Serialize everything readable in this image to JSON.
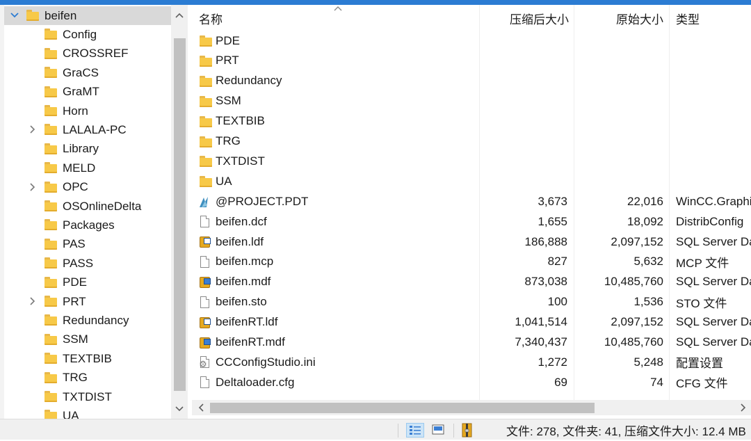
{
  "tree": {
    "items": [
      {
        "label": "beifen",
        "level": 0,
        "expanded": true,
        "selected": true
      },
      {
        "label": "Config",
        "level": 1
      },
      {
        "label": "CROSSREF",
        "level": 1
      },
      {
        "label": "GraCS",
        "level": 1
      },
      {
        "label": "GraMT",
        "level": 1
      },
      {
        "label": "Horn",
        "level": 1
      },
      {
        "label": "LALALA-PC",
        "level": 1,
        "has_children": true
      },
      {
        "label": "Library",
        "level": 1
      },
      {
        "label": "MELD",
        "level": 1
      },
      {
        "label": "OPC",
        "level": 1,
        "has_children": true
      },
      {
        "label": "OSOnlineDelta",
        "level": 1
      },
      {
        "label": "Packages",
        "level": 1
      },
      {
        "label": "PAS",
        "level": 1
      },
      {
        "label": "PASS",
        "level": 1
      },
      {
        "label": "PDE",
        "level": 1
      },
      {
        "label": "PRT",
        "level": 1,
        "has_children": true
      },
      {
        "label": "Redundancy",
        "level": 1
      },
      {
        "label": "SSM",
        "level": 1
      },
      {
        "label": "TEXTBIB",
        "level": 1
      },
      {
        "label": "TRG",
        "level": 1
      },
      {
        "label": "TXTDIST",
        "level": 1
      },
      {
        "label": "UA",
        "level": 1
      }
    ],
    "scroll_up_icon": "chevron-up-icon",
    "scroll_down_icon": "chevron-down-icon"
  },
  "list": {
    "columns": {
      "name": "名称",
      "compressed": "压缩后大小",
      "original": "原始大小",
      "type": "类型"
    },
    "rows": [
      {
        "icon": "folder-icon",
        "name": "PDE",
        "compressed": "",
        "original": "",
        "type": ""
      },
      {
        "icon": "folder-icon",
        "name": "PRT",
        "compressed": "",
        "original": "",
        "type": ""
      },
      {
        "icon": "folder-icon",
        "name": "Redundancy",
        "compressed": "",
        "original": "",
        "type": ""
      },
      {
        "icon": "folder-icon",
        "name": "SSM",
        "compressed": "",
        "original": "",
        "type": ""
      },
      {
        "icon": "folder-icon",
        "name": "TEXTBIB",
        "compressed": "",
        "original": "",
        "type": ""
      },
      {
        "icon": "folder-icon",
        "name": "TRG",
        "compressed": "",
        "original": "",
        "type": ""
      },
      {
        "icon": "folder-icon",
        "name": "TXTDIST",
        "compressed": "",
        "original": "",
        "type": ""
      },
      {
        "icon": "folder-icon",
        "name": "UA",
        "compressed": "",
        "original": "",
        "type": ""
      },
      {
        "icon": "wincc-graphics-icon",
        "name": "@PROJECT.PDT",
        "compressed": "3,673",
        "original": "22,016",
        "type": "WinCC.Graphi"
      },
      {
        "icon": "document-icon",
        "name": "beifen.dcf",
        "compressed": "1,655",
        "original": "18,092",
        "type": "DistribConfig"
      },
      {
        "icon": "database-log-icon",
        "name": "beifen.ldf",
        "compressed": "186,888",
        "original": "2,097,152",
        "type": "SQL Server Da"
      },
      {
        "icon": "document-icon",
        "name": "beifen.mcp",
        "compressed": "827",
        "original": "5,632",
        "type": "MCP 文件"
      },
      {
        "icon": "database-data-icon",
        "name": "beifen.mdf",
        "compressed": "873,038",
        "original": "10,485,760",
        "type": "SQL Server Da"
      },
      {
        "icon": "document-icon",
        "name": "beifen.sto",
        "compressed": "100",
        "original": "1,536",
        "type": "STO 文件"
      },
      {
        "icon": "database-log-icon",
        "name": "beifenRT.ldf",
        "compressed": "1,041,514",
        "original": "2,097,152",
        "type": "SQL Server Da"
      },
      {
        "icon": "database-data-icon",
        "name": "beifenRT.mdf",
        "compressed": "7,340,437",
        "original": "10,485,760",
        "type": "SQL Server Da"
      },
      {
        "icon": "settings-file-icon",
        "name": "CCConfigStudio.ini",
        "compressed": "1,272",
        "original": "5,248",
        "type": "配置设置"
      },
      {
        "icon": "document-icon",
        "name": "Deltaloader.cfg",
        "compressed": "69",
        "original": "74",
        "type": "CFG 文件"
      }
    ]
  },
  "hscroll": {
    "left_icon": "chevron-left-icon",
    "right_icon": "chevron-right-icon"
  },
  "status": {
    "text": "文件: 278, 文件夹: 41, 压缩文件大小: 12.4 MB",
    "details_view_icon": "details-view-icon",
    "large_icons_view_icon": "large-icons-view-icon",
    "archive_icon": "archive-icon"
  },
  "colors": {
    "accent": "#2b7cd3",
    "folder": "#f7c948",
    "selected": "#d9d9d9"
  }
}
